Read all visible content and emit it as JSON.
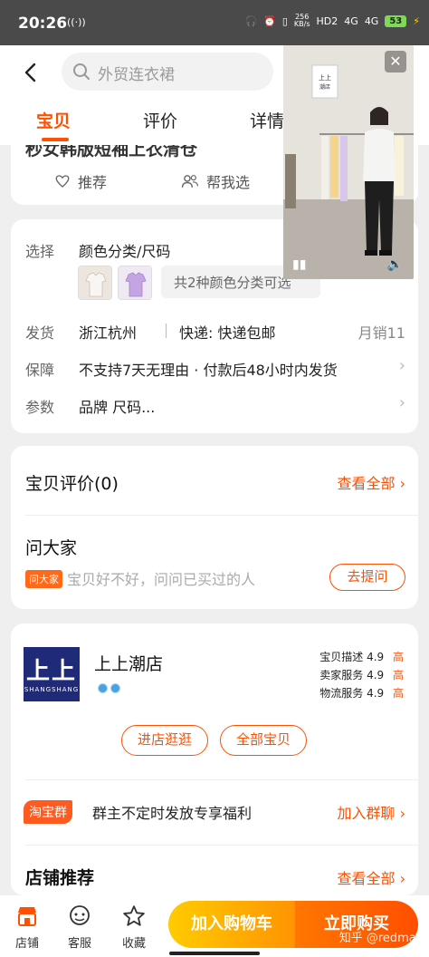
{
  "status_bar": {
    "time": "20:26",
    "speed_top": "256",
    "speed_bottom": "KB/s",
    "hd": "HD2",
    "net1": "4G",
    "net2": "4G",
    "battery": "53"
  },
  "search": {
    "placeholder": "外贸连衣裙"
  },
  "tabs": [
    {
      "label": "宝贝"
    },
    {
      "label": "评价"
    },
    {
      "label": "详情"
    }
  ],
  "title_card": {
    "title_partial": "秒女韩版短袖上衣清仓",
    "recommend": "推荐",
    "help_choose": "帮我选"
  },
  "spec": {
    "select_label": "选择",
    "select_value": "颜色分类/尺码",
    "more_colors": "共2种颜色分类可选",
    "ship_label": "发货",
    "ship_from": "浙江杭州",
    "delivery": "快递: 快递包邮",
    "monthly_sales": "月销11",
    "guarantee_label": "保障",
    "guarantee_value": "不支持7天无理由 · 付款后48小时内发货",
    "params_label": "参数",
    "params_value": "品牌 尺码..."
  },
  "reviews": {
    "title": "宝贝评价(0)",
    "see_all": "查看全部"
  },
  "ask": {
    "title": "问大家",
    "tag": "问大家",
    "placeholder": "宝贝好不好，问问已买过的人",
    "button": "去提问"
  },
  "shop": {
    "logo_big": "上上",
    "logo_small": "SHANGSHANG",
    "name": "上上潮店",
    "scores": [
      {
        "label": "宝贝描述",
        "value": "4.9",
        "level": "高"
      },
      {
        "label": "卖家服务",
        "value": "4.9",
        "level": "高"
      },
      {
        "label": "物流服务",
        "value": "4.9",
        "level": "高"
      }
    ],
    "visit_button": "进店逛逛",
    "all_items_button": "全部宝贝",
    "group_tag": "淘宝群",
    "group_text": "群主不定时发放专享福利",
    "join_group": "加入群聊",
    "recommend_title": "店铺推荐",
    "recommend_all": "查看全部"
  },
  "video": {
    "sign_text": "上上\n潮店"
  },
  "bottom_bar": {
    "store": "店铺",
    "service": "客服",
    "favorite": "收藏",
    "add_to_cart": "加入购物车",
    "buy_now": "立即购买"
  },
  "watermark": "知乎 @redman",
  "colors": {
    "accent": "#ff5000",
    "cart_gradient": [
      "#ffcb00",
      "#ff9402"
    ],
    "buy_gradient": [
      "#ff7700",
      "#ff4e00"
    ],
    "shop_logo": "#1f2a78"
  }
}
